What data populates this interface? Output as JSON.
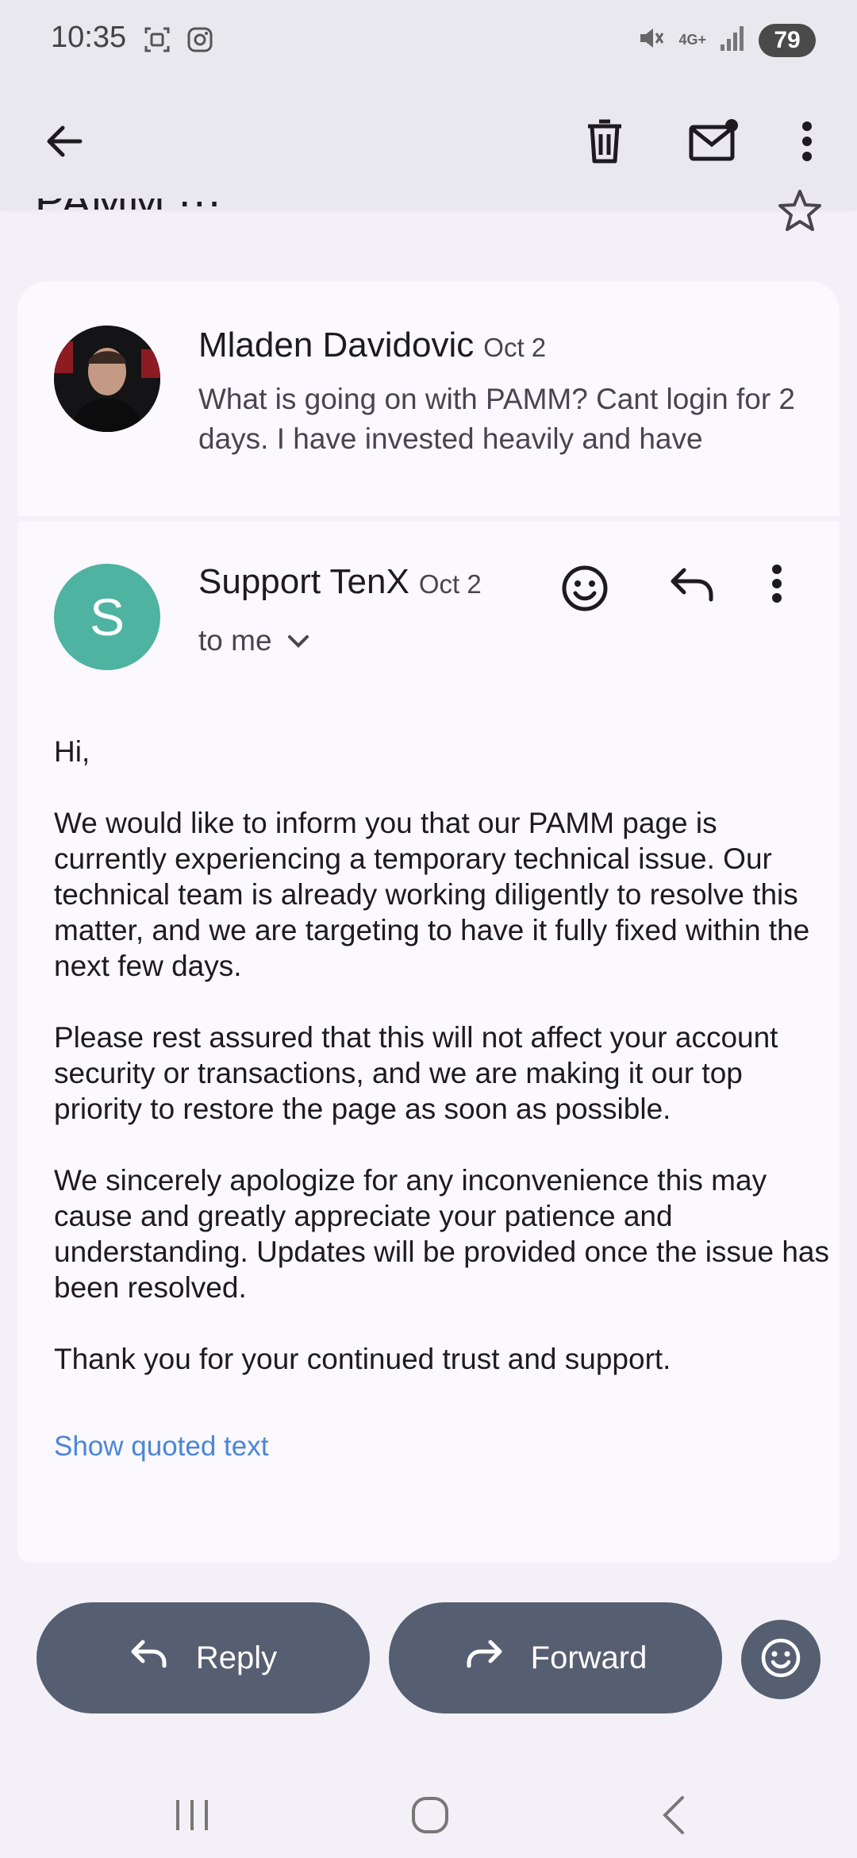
{
  "status_bar": {
    "time": "10:35",
    "network": "4G+",
    "battery": "79"
  },
  "toolbar": {
    "back_icon": "arrow-back-icon",
    "delete_icon": "trash-icon",
    "mark_unread_icon": "mail-unread-icon",
    "more_icon": "more-vert-icon"
  },
  "subject": {
    "text": "PAMM ···"
  },
  "messages": [
    {
      "sender": "Mladen Davidovic",
      "date": "Oct 2",
      "snippet": "What is going on with PAMM? Cant login for 2 days. I have invested heavily and have"
    },
    {
      "avatar_letter": "S",
      "sender": "Support TenX",
      "date": "Oct 2",
      "recipient": "to me",
      "body": [
        "Hi,",
        "We would like to inform you that our PAMM page is currently experiencing a temporary technical issue. Our technical team is already working diligently to resolve this matter, and we are targeting to have it fully fixed within the next few days.",
        "Please rest assured that this will not affect your account security or transactions, and we are making it our top priority to restore the page as soon as possible.",
        "We sincerely apologize for any inconvenience this may cause and greatly appreciate your patience and understanding. Updates will be provided once the issue has been resolved.",
        "Thank you for your continued trust and support."
      ],
      "quoted_link": "Show quoted text"
    }
  ],
  "actions": {
    "reply": "Reply",
    "forward": "Forward"
  },
  "colors": {
    "avatar_s": "#4fb3a1",
    "pill": "#565e71",
    "link": "#4a86d8",
    "background": "#f3f1f7"
  }
}
